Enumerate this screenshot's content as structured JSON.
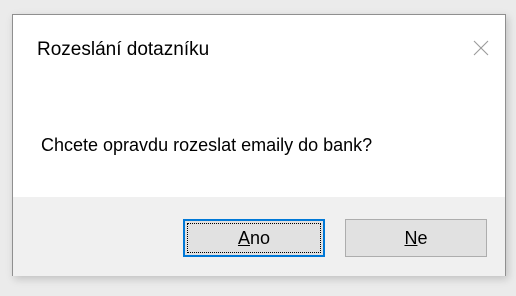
{
  "window": {
    "title": "Rozeslání dotazníku",
    "close_icon": "close-icon"
  },
  "message": {
    "text": "Chcete opravdu rozeslat emaily do bank?"
  },
  "buttons": {
    "yes": {
      "mnemonic": "A",
      "rest": "no",
      "full_label": "Ano"
    },
    "no": {
      "mnemonic": "N",
      "rest": "e",
      "full_label": "Ne"
    }
  },
  "colors": {
    "accent_focus": "#0078d7",
    "footer_bg": "#f0f0f0",
    "button_bg": "#e1e1e1",
    "button_border": "#adadad"
  }
}
